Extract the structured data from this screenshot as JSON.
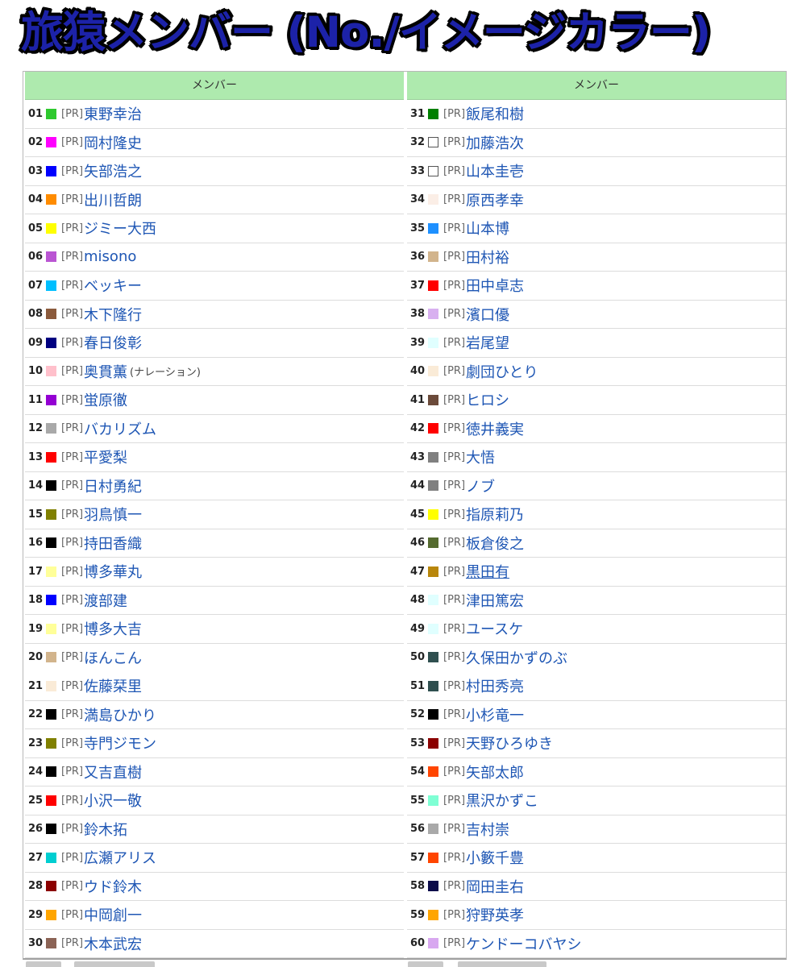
{
  "title": "旅猿メンバー (No./イメージカラー)",
  "columns": [
    {
      "header": "メンバー",
      "rows": [
        {
          "no": "01",
          "color": "#2ec92e",
          "prefix": "[PR]",
          "name": "東野幸治"
        },
        {
          "no": "02",
          "color": "#ff00ff",
          "prefix": "[PR]",
          "name": "岡村隆史"
        },
        {
          "no": "03",
          "color": "#0000ff",
          "prefix": "[PR]",
          "name": "矢部浩之"
        },
        {
          "no": "04",
          "color": "#ff8c00",
          "prefix": "[PR]",
          "name": "出川哲朗"
        },
        {
          "no": "05",
          "color": "#ffff00",
          "prefix": "[PR]",
          "name": "ジミー大西"
        },
        {
          "no": "06",
          "color": "#ba55d3",
          "prefix": "[PR]",
          "name": "misono"
        },
        {
          "no": "07",
          "color": "#00bfff",
          "prefix": "[PR]",
          "name": "ベッキー"
        },
        {
          "no": "08",
          "color": "#8b5a3c",
          "prefix": "[PR]",
          "name": "木下隆行"
        },
        {
          "no": "09",
          "color": "#000080",
          "prefix": "[PR]",
          "name": "春日俊彰"
        },
        {
          "no": "10",
          "color": "#ffc0cb",
          "prefix": "[PR]",
          "name": "奥貫薫",
          "note": "(ナレーション)"
        },
        {
          "no": "11",
          "color": "#9400d3",
          "prefix": "[PR]",
          "name": "蛍原徹"
        },
        {
          "no": "12",
          "color": "#a9a9a9",
          "prefix": "[PR]",
          "name": "バカリズム"
        },
        {
          "no": "13",
          "color": "#ff0000",
          "prefix": "[PR]",
          "name": "平愛梨"
        },
        {
          "no": "14",
          "color": "#000000",
          "prefix": "[PR]",
          "name": "日村勇紀"
        },
        {
          "no": "15",
          "color": "#808000",
          "prefix": "[PR]",
          "name": "羽鳥慎一"
        },
        {
          "no": "16",
          "color": "#000000",
          "prefix": "[PR]",
          "name": "持田香織"
        },
        {
          "no": "17",
          "color": "#ffff99",
          "prefix": "[PR]",
          "name": "博多華丸"
        },
        {
          "no": "18",
          "color": "#0000ff",
          "prefix": "[PR]",
          "name": "渡部建"
        },
        {
          "no": "19",
          "color": "#ffff99",
          "prefix": "[PR]",
          "name": "博多大吉"
        },
        {
          "no": "20",
          "color": "#d2b48c",
          "prefix": "[PR]",
          "name": "ほんこん"
        },
        {
          "no": "21",
          "color": "#faebd7",
          "prefix": "[PR]",
          "name": "佐藤栞里"
        },
        {
          "no": "22",
          "color": "#000000",
          "prefix": "[PR]",
          "name": "満島ひかり"
        },
        {
          "no": "23",
          "color": "#808000",
          "prefix": "[PR]",
          "name": "寺門ジモン"
        },
        {
          "no": "24",
          "color": "#000000",
          "prefix": "[PR]",
          "name": "又吉直樹"
        },
        {
          "no": "25",
          "color": "#ff0000",
          "prefix": "[PR]",
          "name": "小沢一敬"
        },
        {
          "no": "26",
          "color": "#000000",
          "prefix": "[PR]",
          "name": "鈴木拓"
        },
        {
          "no": "27",
          "color": "#00ced1",
          "prefix": "[PR]",
          "name": "広瀬アリス"
        },
        {
          "no": "28",
          "color": "#8b0000",
          "prefix": "[PR]",
          "name": "ウド鈴木"
        },
        {
          "no": "29",
          "color": "#ffa500",
          "prefix": "[PR]",
          "name": "中岡創一"
        },
        {
          "no": "30",
          "color": "#8b6355",
          "prefix": "[PR]",
          "name": "木本武宏"
        }
      ]
    },
    {
      "header": "メンバー",
      "rows": [
        {
          "no": "31",
          "color": "#008000",
          "prefix": "[PR]",
          "name": "飯尾和樹"
        },
        {
          "no": "32",
          "color": "#ffffff",
          "blank": true,
          "prefix": "[PR]",
          "name": "加藤浩次"
        },
        {
          "no": "33",
          "color": "#ffffff",
          "blank": true,
          "prefix": "[PR]",
          "name": "山本圭壱"
        },
        {
          "no": "34",
          "color": "#fbeee6",
          "prefix": "[PR]",
          "name": "原西孝幸"
        },
        {
          "no": "35",
          "color": "#1e90ff",
          "prefix": "[PR]",
          "name": "山本博"
        },
        {
          "no": "36",
          "color": "#d2b48c",
          "prefix": "[PR]",
          "name": "田村裕"
        },
        {
          "no": "37",
          "color": "#ff0000",
          "prefix": "[PR]",
          "name": "田中卓志"
        },
        {
          "no": "38",
          "color": "#d8b0f0",
          "prefix": "[PR]",
          "name": "濱口優"
        },
        {
          "no": "39",
          "color": "#e0ffff",
          "prefix": "[PR]",
          "name": "岩尾望"
        },
        {
          "no": "40",
          "color": "#faebd7",
          "prefix": "[PR]",
          "name": "劇団ひとり"
        },
        {
          "no": "41",
          "color": "#6b4a3a",
          "prefix": "[PR]",
          "name": "ヒロシ"
        },
        {
          "no": "42",
          "color": "#ff0000",
          "prefix": "[PR]",
          "name": "徳井義実"
        },
        {
          "no": "43",
          "color": "#808080",
          "prefix": "[PR]",
          "name": "大悟"
        },
        {
          "no": "44",
          "color": "#808080",
          "prefix": "[PR]",
          "name": "ノブ"
        },
        {
          "no": "45",
          "color": "#ffff00",
          "prefix": "[PR]",
          "name": "指原莉乃"
        },
        {
          "no": "46",
          "color": "#556b2f",
          "prefix": "[PR]",
          "name": "板倉俊之"
        },
        {
          "no": "47",
          "color": "#b8860b",
          "prefix": "[PR]",
          "name": "黒田有",
          "underline": true
        },
        {
          "no": "48",
          "color": "#e0ffff",
          "prefix": "[PR]",
          "name": "津田篤宏"
        },
        {
          "no": "49",
          "color": "#e0ffff",
          "prefix": "[PR]",
          "name": "ユースケ"
        },
        {
          "no": "50",
          "color": "#2f4f4f",
          "prefix": "[PR]",
          "name": "久保田かずのぶ"
        },
        {
          "no": "51",
          "color": "#2f4f4f",
          "prefix": "[PR]",
          "name": "村田秀亮"
        },
        {
          "no": "52",
          "color": "#000000",
          "prefix": "[PR]",
          "name": "小杉竜一"
        },
        {
          "no": "53",
          "color": "#8b0000",
          "prefix": "[PR]",
          "name": "天野ひろゆき"
        },
        {
          "no": "54",
          "color": "#ff4500",
          "prefix": "[PR]",
          "name": "矢部太郎"
        },
        {
          "no": "55",
          "color": "#7fffd4",
          "prefix": "[PR]",
          "name": "黒沢かずこ"
        },
        {
          "no": "56",
          "color": "#a9a9a9",
          "prefix": "[PR]",
          "name": "吉村崇"
        },
        {
          "no": "57",
          "color": "#ff4500",
          "prefix": "[PR]",
          "name": "小籔千豊"
        },
        {
          "no": "58",
          "color": "#0c0c4a",
          "prefix": "[PR]",
          "name": "岡田圭右"
        },
        {
          "no": "59",
          "color": "#ffa500",
          "prefix": "[PR]",
          "name": "狩野英孝"
        },
        {
          "no": "60",
          "color": "#d8a8f0",
          "prefix": "[PR]",
          "name": "ケンドーコバヤシ"
        }
      ]
    }
  ],
  "colors": {
    "header_bg": "#aeeaae",
    "link": "#1e56b4",
    "title_fill": "#1c22a8"
  }
}
